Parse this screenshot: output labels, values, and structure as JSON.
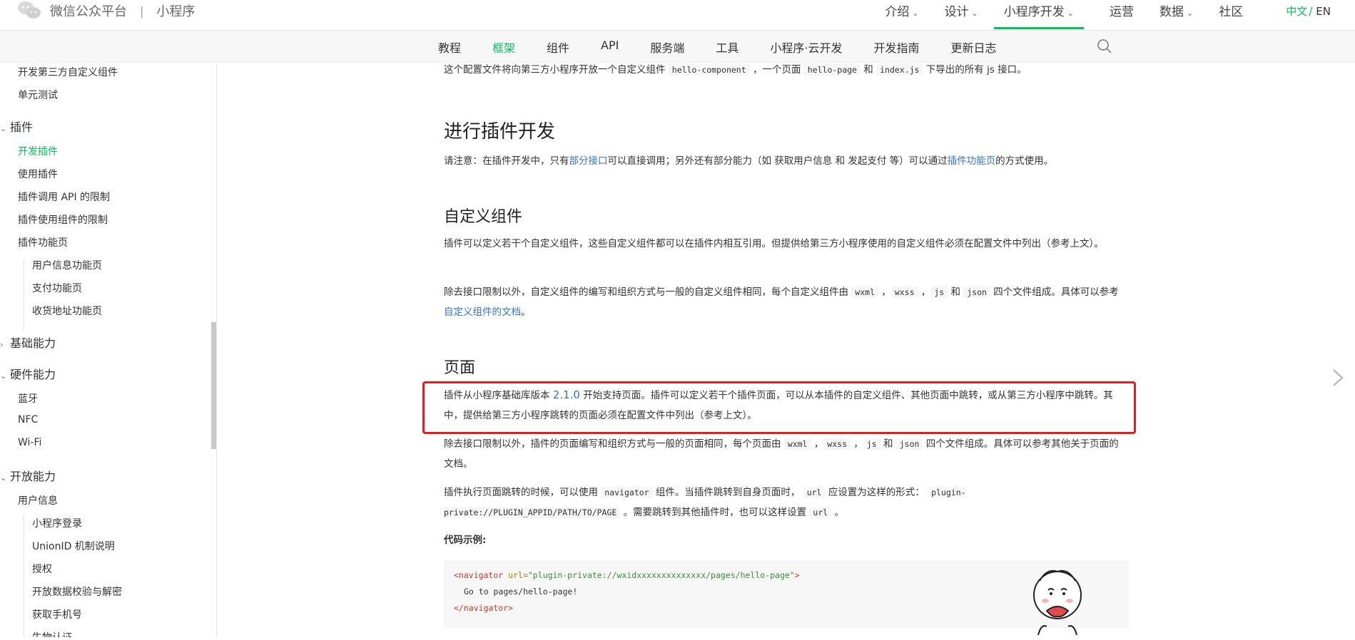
{
  "brand": {
    "name": "微信公众平台",
    "separator": "|",
    "section": "小程序"
  },
  "top_nav": [
    {
      "label": "介绍",
      "dropdown": true
    },
    {
      "label": "设计",
      "dropdown": true
    },
    {
      "label": "小程序开发",
      "dropdown": true,
      "active": true
    },
    {
      "label": "运营",
      "dropdown": false
    },
    {
      "label": "数据",
      "dropdown": true
    },
    {
      "label": "社区",
      "dropdown": false
    }
  ],
  "lang": {
    "zh": "中文",
    "slash": "/",
    "en": "EN"
  },
  "sub_nav": [
    "教程",
    "框架",
    "组件",
    "API",
    "服务端",
    "工具",
    "小程序·云开发",
    "开发指南",
    "更新日志"
  ],
  "sub_nav_active": "框架",
  "sidebar": {
    "items": [
      {
        "label": "开发第三方自定义组件"
      },
      {
        "label": "单元测试"
      },
      {
        "label": "插件",
        "group": true,
        "expanded": true
      },
      {
        "label": "开发插件",
        "active": true
      },
      {
        "label": "使用插件"
      },
      {
        "label": "插件调用 API 的限制"
      },
      {
        "label": "插件使用组件的限制"
      },
      {
        "label": "插件功能页"
      },
      {
        "label": "用户信息功能页"
      },
      {
        "label": "支付功能页"
      },
      {
        "label": "收货地址功能页"
      },
      {
        "label": "基础能力",
        "group": true,
        "expanded": false
      },
      {
        "label": "硬件能力",
        "group": true,
        "expanded": true
      },
      {
        "label": "蓝牙"
      },
      {
        "label": "NFC"
      },
      {
        "label": "Wi-Fi"
      },
      {
        "label": "开放能力",
        "group": true,
        "expanded": true
      },
      {
        "label": "用户信息"
      },
      {
        "label": "小程序登录"
      },
      {
        "label": "UnionID 机制说明"
      },
      {
        "label": "授权"
      },
      {
        "label": "开放数据校验与解密"
      },
      {
        "label": "获取手机号"
      },
      {
        "label": "生物认证"
      }
    ]
  },
  "content": {
    "intro": {
      "t1": "这个配置文件将向第三方小程序开放一个自定义组件 ",
      "c1": "hello-component",
      "t2": " ，一个页面 ",
      "c2": "hello-page",
      "t3": " 和 ",
      "c3": "index.js",
      "t4": " 下导出的所有 js 接口。"
    },
    "h_dev": "进行插件开发",
    "note": {
      "t1": "请注意：在插件开发中，只有",
      "link1": "部分接口",
      "t2": "可以直接调用；另外还有部分能力（如 获取用户信息 和 发起支付 等）可以通过",
      "link2": "插件功能页",
      "t3": "的方式使用。"
    },
    "h_custom": "自定义组件",
    "custom_p1": "插件可以定义若干个自定义组件，这些自定义组件都可以在插件内相互引用。但提供给第三方小程序使用的自定义组件必须在配置文件中列出（参考上文）。",
    "custom_p2": {
      "t1": "除去接口限制以外，自定义组件的编写和组织方式与一般的自定义组件相同，每个自定义组件由 ",
      "c1": "wxml",
      "s1": " ，",
      "c2": "wxss",
      "s2": " ，",
      "c3": "js",
      "s3": " 和 ",
      "c4": "json",
      "t2": " 四个文件组成。具体可以参考",
      "link": "自定义组件的文档",
      "t3": "。"
    },
    "h_page": "页面",
    "page_p1": {
      "t1": "插件从小程序基础库版本 ",
      "version": "2.1.0",
      "t2": " 开始支持页面。插件可以定义若干个插件页面，可以从本插件的自定义组件、其他页面中跳转，或从第三方小程序中跳转。其中，提供给第三方小程序跳转的页面必须在配置文件中列出（参考上文）。"
    },
    "page_p2": {
      "t1": "除去接口限制以外，插件的页面编写和组织方式与一般的页面相同，每个页面由 ",
      "c1": "wxml",
      "s1": " ，",
      "c2": "wxss",
      "s2": " ，",
      "c3": "js",
      "s3": " 和 ",
      "c4": "json",
      "t2": " 四个文件组成。具体可以参考其他关于页面的文档。"
    },
    "page_p3": {
      "t1": "插件执行页面跳转的时候，可以使用 ",
      "c1": "navigator",
      "t2": " 组件。当插件跳转到自身页面时， ",
      "c2": "url",
      "t3": " 应设置为这样的形式： ",
      "c3": "plugin-private://PLUGIN_APPID/PATH/TO/PAGE",
      "t4": " 。需要跳转到其他插件时，也可以这样设置 ",
      "c4": "url",
      "t5": " 。"
    },
    "code_label": "代码示例:",
    "code": {
      "open_tag": "<navigator",
      "attr": " url=",
      "value": "\"plugin-private://wxidxxxxxxxxxxxxxx/pages/hello-page\"",
      "close_bracket": ">",
      "body": "Go to pages/hello-page!",
      "close_tag": "</navigator>"
    }
  },
  "colors": {
    "accent": "#07c160",
    "link": "#3574c7",
    "highlight_border": "#e0201e"
  },
  "icons": [
    "wechat-logo-icon",
    "search-icon",
    "chevron-right-icon",
    "chevron-down-icon",
    "mascot-icon"
  ]
}
